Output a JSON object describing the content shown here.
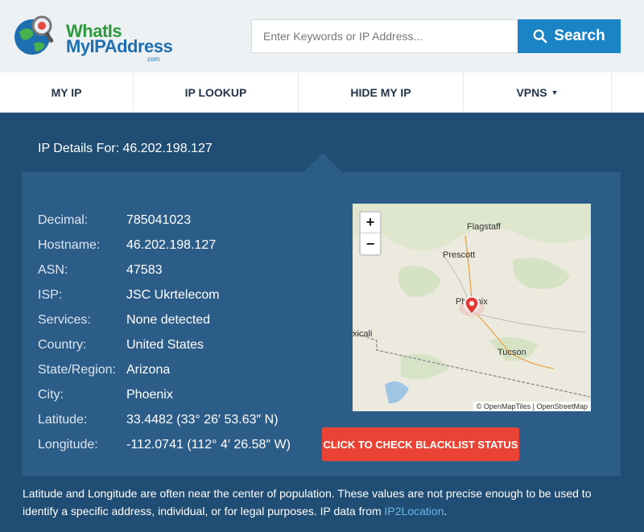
{
  "header": {
    "logo": {
      "line1": "WhatIs",
      "line2": "MyIPAddress",
      "line3": ".com"
    },
    "search": {
      "placeholder": "Enter Keywords or IP Address...",
      "button_label": "Search"
    }
  },
  "nav": {
    "items": [
      {
        "label": "MY IP"
      },
      {
        "label": "IP LOOKUP"
      },
      {
        "label": "HIDE MY IP"
      },
      {
        "label": "VPNS"
      }
    ],
    "dropdown_caret": "▼"
  },
  "ip_details": {
    "heading": "IP Details For: 46.202.198.127",
    "rows": [
      {
        "label": "Decimal:",
        "value": "785041023"
      },
      {
        "label": "Hostname:",
        "value": "46.202.198.127"
      },
      {
        "label": "ASN:",
        "value": "47583"
      },
      {
        "label": "ISP:",
        "value": "JSC Ukrtelecom"
      },
      {
        "label": "Services:",
        "value": "None detected"
      },
      {
        "label": "Country:",
        "value": "United States"
      },
      {
        "label": "State/Region:",
        "value": "Arizona"
      },
      {
        "label": "City:",
        "value": "Phoenix"
      },
      {
        "label": "Latitude:",
        "value": "33.4482 (33° 26′ 53.63″ N)"
      },
      {
        "label": "Longitude:",
        "value": "-112.0741 (112° 4′ 26.58″ W)"
      }
    ]
  },
  "map": {
    "zoom_in": "+",
    "zoom_out": "−",
    "places": [
      "Flagstaff",
      "Prescott",
      "Phoenix",
      "Tucson",
      "xicali"
    ],
    "attribution": "© OpenMapTiles | OpenStreetMap"
  },
  "blacklist_button": "CLICK TO CHECK BLACKLIST STATUS",
  "footer_note": {
    "text": "Latitude and Longitude are often near the center of population. These values are not precise enough to be used to identify a specific address, individual, or for legal purposes. IP data from ",
    "link": "IP2Location",
    "end": "."
  },
  "colors": {
    "page_bg": "#1f4d74",
    "panel_bg": "#2c5d88",
    "search_button": "#1a84c4",
    "blacklist_button": "#ea4335",
    "link": "#6fb6e8"
  }
}
